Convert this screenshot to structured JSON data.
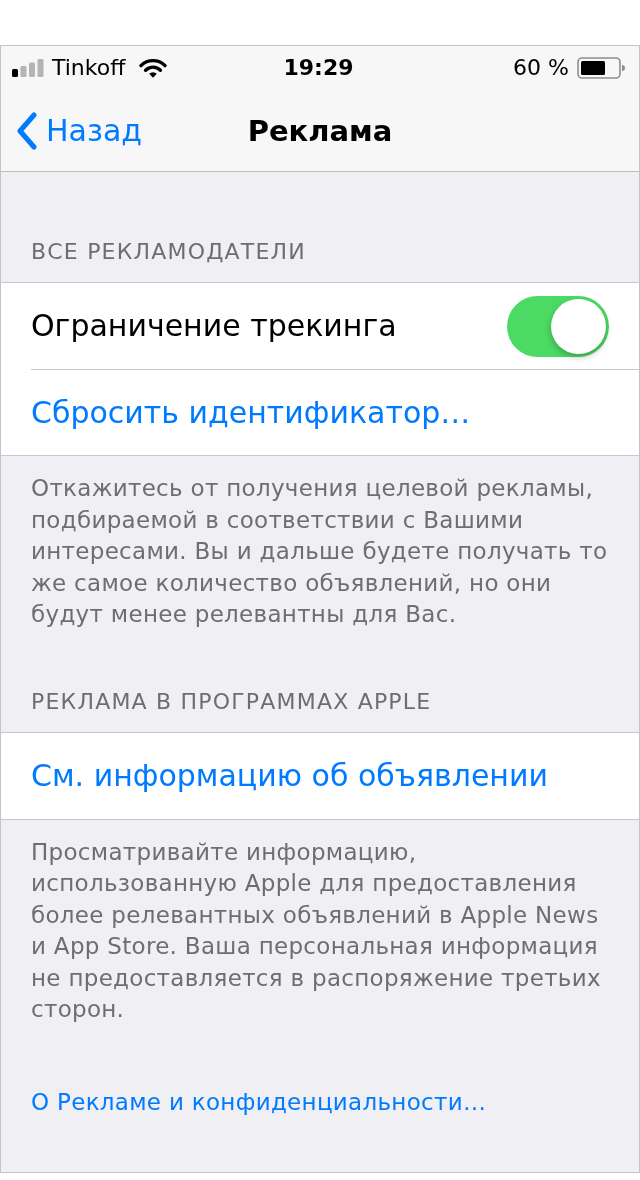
{
  "status_bar": {
    "carrier": "Tinkoff",
    "time": "19:29",
    "battery": "60 %"
  },
  "nav_bar": {
    "back": "Назад",
    "title": "Реклама"
  },
  "sections": [
    {
      "header": "ВСЕ РЕКЛАМОДАТЕЛИ",
      "rows": [
        {
          "kind": "toggle",
          "label": "Ограничение трекинга",
          "on": true
        },
        {
          "kind": "link",
          "label": "Сбросить идентификатор…"
        }
      ],
      "footer": "Откажитесь от получения целевой рекламы, подбираемой в соответствии с Вашими интересами. Вы и дальше будете получать то же самое количество объявлений, но они будут менее релевантны для Вас."
    },
    {
      "header": "РЕКЛАМА В ПРОГРАММАХ APPLE",
      "rows": [
        {
          "kind": "link",
          "label": "См. информацию об объявлении"
        }
      ],
      "footer": "Просматривайте информацию, использованную Apple для предоставления более релевантных объявлений в Apple News и App Store. Ваша персональная информация не предоставляется в распоряжение третьих сторон."
    }
  ],
  "about_link": "О Рекламе и конфиденциальности…"
}
